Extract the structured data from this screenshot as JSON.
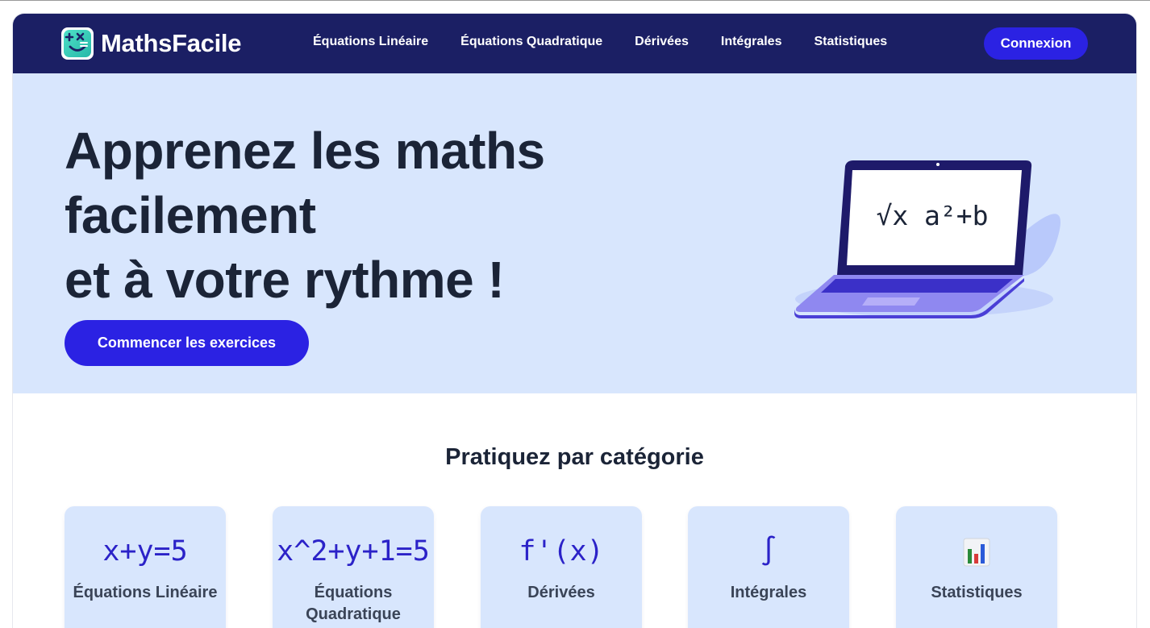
{
  "brand": {
    "name": "MathsFacile",
    "logo_icon": "math-operators-smile-logo"
  },
  "nav": {
    "links": [
      {
        "label": "Équations Linéaire"
      },
      {
        "label": "Équations Quadratique"
      },
      {
        "label": "Dérivées"
      },
      {
        "label": "Intégrales"
      },
      {
        "label": "Statistiques"
      }
    ],
    "login_label": "Connexion"
  },
  "hero": {
    "title_lines": [
      "Apprenez les maths",
      "facilement",
      "et à votre rythme !"
    ],
    "cta_label": "Commencer les exercices",
    "laptop_screen_text": "√x  a²+b"
  },
  "categories": {
    "title": "Pratiquez par catégorie",
    "items": [
      {
        "symbol": "x+y=5",
        "label": "Équations Linéaire"
      },
      {
        "symbol": "x^2+y+1=5",
        "label": "Équations Quadratique"
      },
      {
        "symbol": "f'(x)",
        "label": "Dérivées"
      },
      {
        "symbol": "∫",
        "label": "Intégrales"
      },
      {
        "symbol": "",
        "icon": "bar-chart-icon",
        "label": "Statistiques"
      }
    ]
  },
  "colors": {
    "navbar": "#1b1f64",
    "accent": "#2b22e3",
    "hero_bg": "#d8e6fd",
    "text_dark": "#1b2437"
  }
}
